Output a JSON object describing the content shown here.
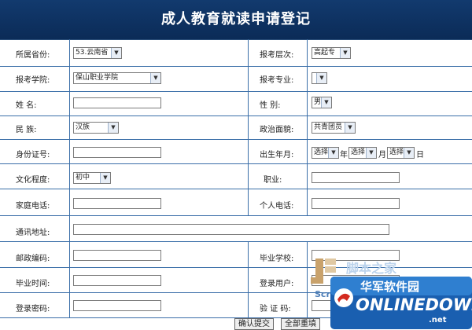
{
  "page": {
    "title": "成人教育就读申请登记"
  },
  "form": {
    "province_label": "所属省份:",
    "province_value": "53.云南省",
    "exam_level_label": "报考层次:",
    "exam_level_value": "高起专",
    "college_label": "报考学院:",
    "college_value": "保山职业学院",
    "major_label": "报考专业:",
    "major_value": "",
    "name_label": "姓 名:",
    "gender_label": "性 别:",
    "gender_value": "男",
    "ethnicity_label": "民 族:",
    "ethnicity_value": "汉族",
    "political_label": "政治面貌:",
    "political_value": "共青团员",
    "id_label": "身份证号:",
    "birth_label": "出生年月:",
    "birth_year_value": "选择",
    "birth_year_unit": "年",
    "birth_month_value": "选择",
    "birth_month_unit": "月",
    "birth_day_value": "选择",
    "birth_day_unit": "日",
    "education_label": "文化程度:",
    "education_value": "初中",
    "job_label": "职业:",
    "home_phone_label": "家庭电话:",
    "mobile_label": "个人电话:",
    "address_label": "通讯地址:",
    "postcode_label": "邮政编码:",
    "grad_school_label": "毕业学校:",
    "grad_time_label": "毕业时间:",
    "login_user_label": "登录用户:",
    "login_pwd_label": "登录密码:",
    "verify_label": "验 证 码:"
  },
  "buttons": {
    "submit_label": "确认提交",
    "reset_label": "全部重填"
  },
  "watermark": {
    "cn_text": "华军软件园",
    "en_text": "ONLINEDOWN",
    "suffix": ".net",
    "script_text": "Scri",
    "jb_text": "脚本之家"
  },
  "colors": {
    "header_bg": "#123a6e",
    "grid_line": "#3a6ea8",
    "watermark_blue": "#1a4f9c",
    "watermark_red": "#d32a1f"
  }
}
